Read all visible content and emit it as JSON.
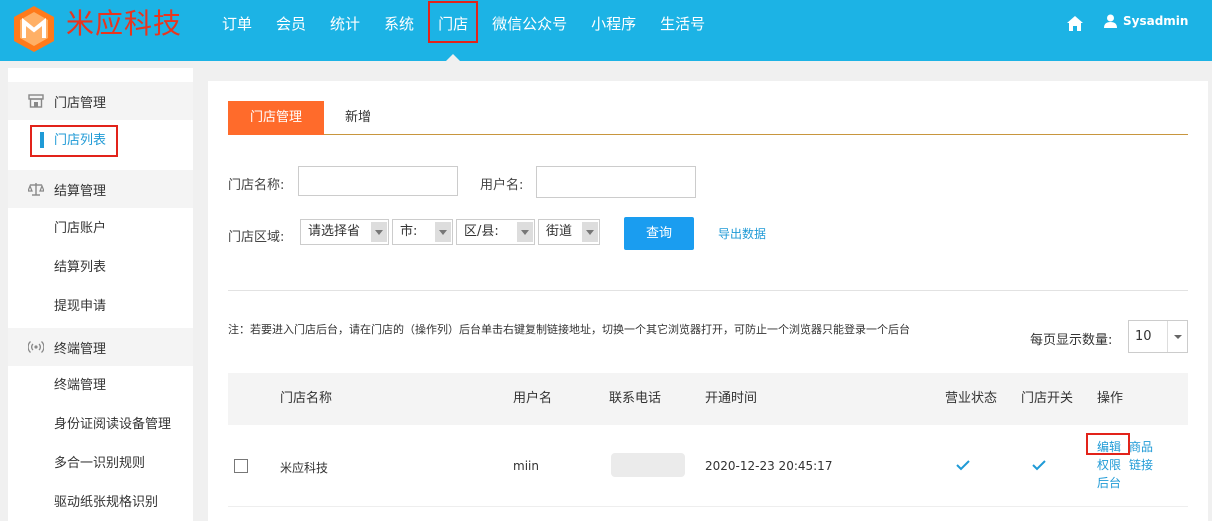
{
  "brand": {
    "name": "米应科技",
    "colors": {
      "primary": "#1cb3e5",
      "accent": "#ff6b2b",
      "brand_red": "#e8351e",
      "link": "#1f9ad6"
    }
  },
  "nav": {
    "items": [
      "订单",
      "会员",
      "统计",
      "系统",
      "门店",
      "微信公众号",
      "小程序",
      "生活号"
    ],
    "active": "门店"
  },
  "header": {
    "user": "Sysadmin"
  },
  "sidebar": {
    "groups": [
      {
        "label": "门店管理",
        "icon": "store-icon",
        "items": [
          "门店列表"
        ]
      },
      {
        "label": "结算管理",
        "icon": "scale-icon",
        "items": [
          "门店账户",
          "结算列表",
          "提现申请"
        ]
      },
      {
        "label": "终端管理",
        "icon": "signal-icon",
        "items": [
          "终端管理",
          "身份证阅读设备管理",
          "多合一识别规则",
          "驱动纸张规格识别"
        ]
      }
    ],
    "active_item": "门店列表"
  },
  "tabs": {
    "active": "门店管理",
    "new": "新增"
  },
  "filters": {
    "store_name_label": "门店名称:",
    "username_label": "用户名:",
    "region_label": "门店区域:",
    "province": "请选择省",
    "city": "市:",
    "district": "区/县:",
    "street": "街道",
    "query_button": "查询",
    "export_link": "导出数据"
  },
  "note": "注：若要进入门店后台，请在门店的（操作列）后台单击右键复制链接地址，切换一个其它浏览器打开，可防止一个浏览器只能登录一个后台",
  "page_size": {
    "label": "每页显示数量:",
    "value": "10"
  },
  "table": {
    "headers": [
      "门店名称",
      "用户名",
      "联系电话",
      "开通时间",
      "营业状态",
      "门店开关",
      "操作"
    ],
    "rows": [
      {
        "name": "米应科技",
        "username": "miin",
        "phone": "",
        "opened": "2020-12-23 20:45:17",
        "business_status": true,
        "store_switch": true
      }
    ],
    "ops": {
      "edit": "编辑",
      "goods_line1": "商品",
      "goods_line2": "链接",
      "perm_line1": "权限",
      "perm_line2": "后台"
    }
  }
}
